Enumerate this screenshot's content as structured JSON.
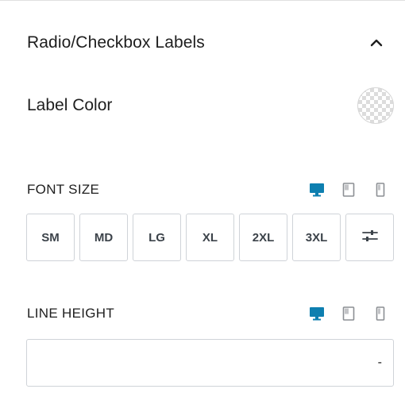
{
  "section": {
    "title": "Radio/Checkbox Labels",
    "expanded": true
  },
  "label_color": {
    "label": "Label Color",
    "value": "transparent"
  },
  "font_size": {
    "label": "FONT SIZE",
    "devices": [
      "desktop",
      "tablet",
      "mobile"
    ],
    "active_device": "desktop",
    "options": [
      "SM",
      "MD",
      "LG",
      "XL",
      "2XL",
      "3XL"
    ],
    "custom_icon": "sliders-icon"
  },
  "line_height": {
    "label": "LINE HEIGHT",
    "devices": [
      "desktop",
      "tablet",
      "mobile"
    ],
    "active_device": "desktop",
    "value": "",
    "unit": "-"
  },
  "colors": {
    "active_device": "#0e7fb0",
    "inactive_device": "#8c8f94",
    "border": "#cfd3d8",
    "text": "#1e1e1e"
  }
}
